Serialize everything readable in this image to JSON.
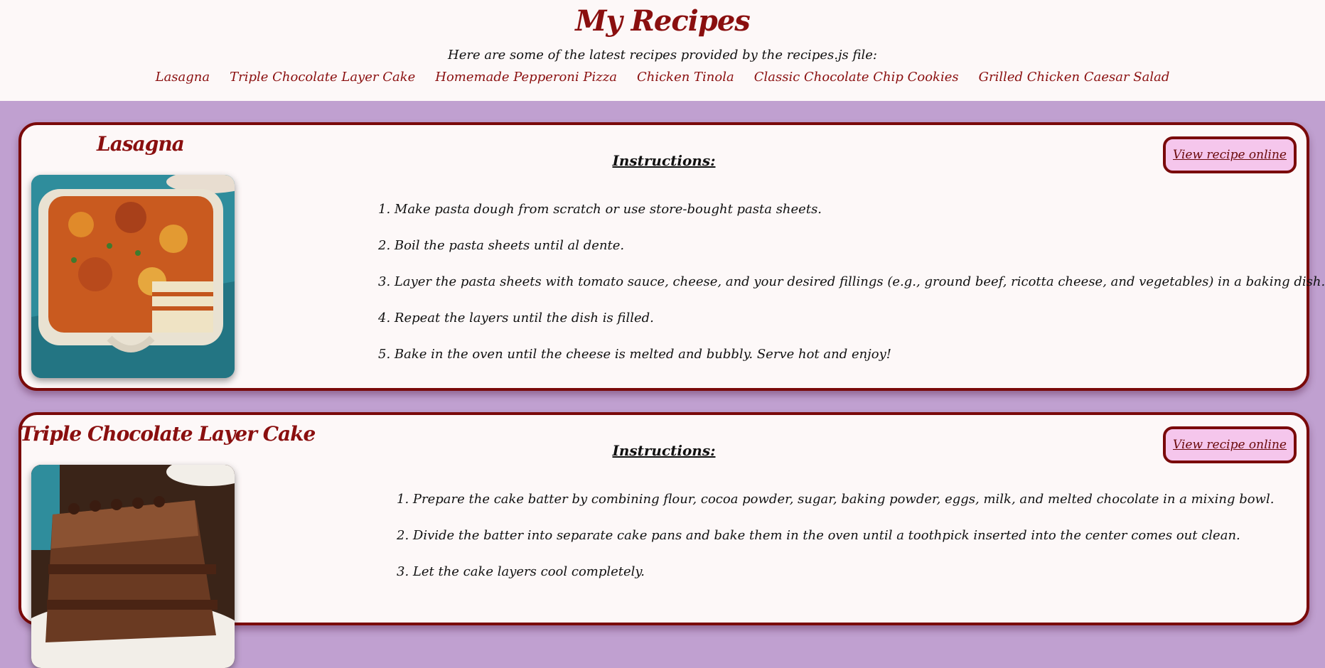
{
  "header": {
    "title": "My Recipes",
    "subtitle_before": "Here are some of the latest recipes provided by the ",
    "subtitle_file": "recipes.js",
    "subtitle_after": " file:"
  },
  "nav": [
    "Lasagna",
    "Triple Chocolate Layer Cake",
    "Homemade Pepperoni Pizza",
    "Chicken Tinola",
    "Classic Chocolate Chip Cookies",
    "Grilled Chicken Caesar Salad"
  ],
  "recipes": [
    {
      "title": "Lasagna",
      "instructions_heading": "Instructions:",
      "view_label": "View recipe online",
      "steps": [
        "1. Make pasta dough from scratch or use store-bought pasta sheets.",
        "2. Boil the pasta sheets until al dente.",
        "3. Layer the pasta sheets with tomato sauce, cheese, and your desired fillings (e.g., ground beef, ricotta cheese, and vegetables) in a baking dish.",
        "4. Repeat the layers until the dish is filled.",
        "5. Bake in the oven until the cheese is melted and bubbly. Serve hot and enjoy!"
      ]
    },
    {
      "title": "Triple Chocolate Layer Cake",
      "instructions_heading": "Instructions:",
      "view_label": "View recipe online",
      "steps": [
        "1. Prepare the cake batter by combining flour, cocoa powder, sugar, baking powder, eggs, milk, and melted chocolate in a mixing bowl.",
        "2. Divide the batter into separate cake pans and bake them in the oven until a toothpick inserted into the center comes out clean.",
        "3. Let the cake layers cool completely."
      ]
    }
  ],
  "colors": {
    "page_bg": "#c0a0d0",
    "accent": "#8a0f0f",
    "card_bg": "#fdf8f8",
    "button_bg": "#f5c6ec"
  }
}
